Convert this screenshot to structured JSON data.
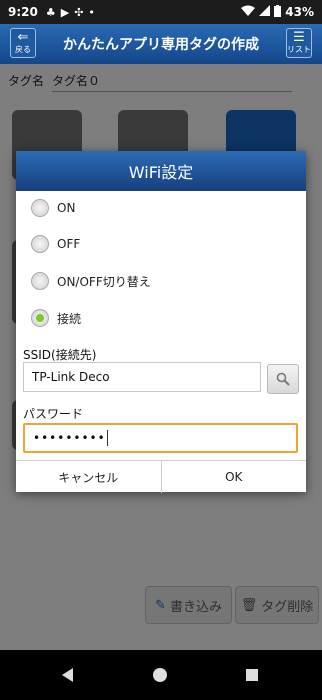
{
  "status_bar": {
    "time": "9:20",
    "battery": "43%"
  },
  "header": {
    "title": "かんたんアプリ専用タグの作成",
    "back_label": "戻る",
    "list_label": "リスト"
  },
  "tag": {
    "label": "タグ名",
    "value": "タグ名０"
  },
  "bottom": {
    "write_label": "書き込み",
    "delete_label": "タグ削除"
  },
  "dialog": {
    "title": "WiFi設定",
    "options": [
      {
        "label": "ON",
        "selected": false
      },
      {
        "label": "OFF",
        "selected": false
      },
      {
        "label": "ON/OFF切り替え",
        "selected": false
      },
      {
        "label": "接続",
        "selected": true
      }
    ],
    "ssid_label": "SSID(接続先)",
    "ssid_value": "TP-Link Deco",
    "password_label": "パスワード",
    "password_value": "•••••••••",
    "cancel_label": "キャンセル",
    "ok_label": "OK"
  },
  "colors": {
    "header_blue": "#14468b",
    "focus_orange": "#f3a332",
    "radio_green": "#7dc92a"
  }
}
